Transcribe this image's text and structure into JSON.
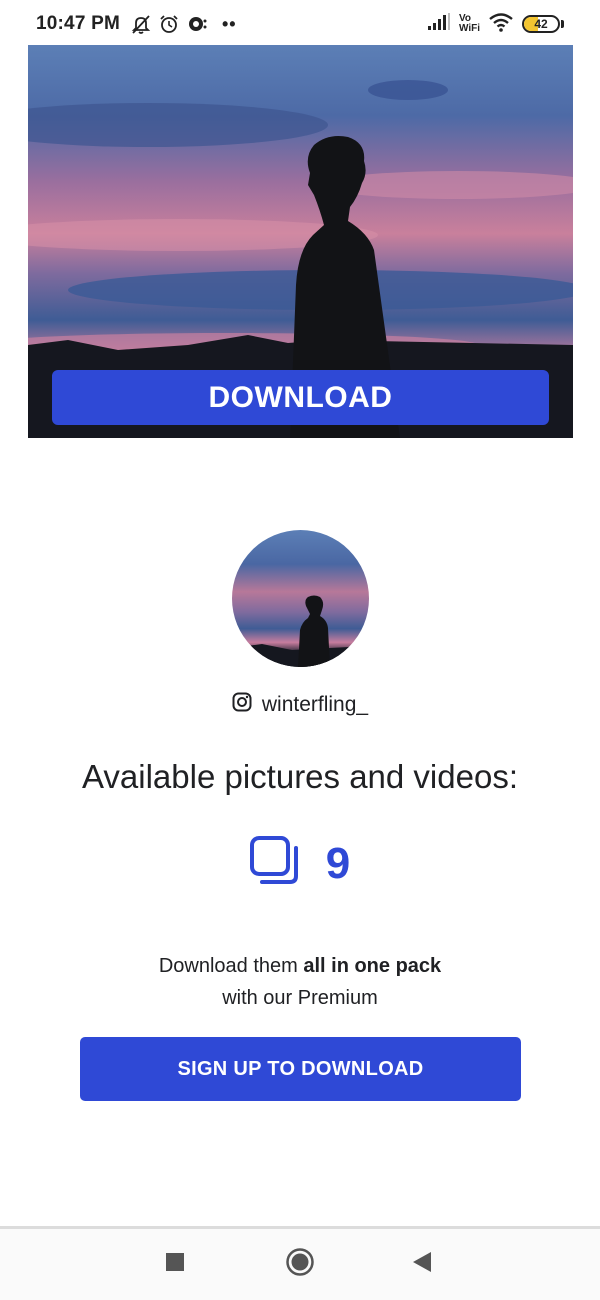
{
  "status_bar": {
    "time": "10:47 PM",
    "dots": "••",
    "vo_top": "Vo",
    "vo_bottom": "WiFi",
    "battery": "42",
    "battery_level_percent": 42,
    "icons": [
      "mute-icon",
      "alarm-icon",
      "notification-icon",
      "signal-icon",
      "wifi-icon",
      "battery-icon"
    ]
  },
  "hero": {
    "download_label": "DOWNLOAD",
    "accent": "#2f49d6"
  },
  "profile": {
    "icon": "instagram-icon",
    "username": "winterfling_"
  },
  "content": {
    "headline": "Available pictures and videos:",
    "count_icon": "gallery-stack-icon",
    "count": "9",
    "promo_prefix": "Download them ",
    "promo_bold": "all in one pack",
    "promo_line2": "with our Premium",
    "signup_label": "SIGN UP TO DOWNLOAD"
  },
  "nav": {
    "icons": [
      "square-icon",
      "home-circle-icon",
      "back-triangle-icon"
    ]
  }
}
